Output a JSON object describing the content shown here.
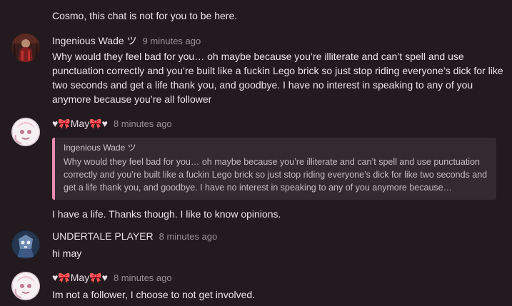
{
  "messages": [
    {
      "text": "Cosmo, this chat is not for you to be here."
    },
    {
      "username": "Ingenious Wade ツ",
      "time": "9 minutes ago",
      "text": "Why would they feel bad for you… oh maybe because you’re illiterate and can’t spell and use punctuation correctly and you’re built like a fuckin Lego brick so just stop riding everyone’s dick for like two seconds and get a life thank you, and goodbye. I have no interest in speaking to any of you anymore because you’re all follower"
    },
    {
      "username": "♥🎀May🎀♥",
      "time": "8 minutes ago",
      "reply": {
        "author": "Ingenious Wade ツ",
        "text": "Why would they feel bad for you… oh maybe because you’re illiterate and can’t spell and use punctuation correctly and you’re built like a fuckin Lego brick so just stop riding everyone’s dick for like two seconds and get a life thank you, and goodbye. I have no interest in speaking to any of you anymore because…"
      },
      "text": "I have a life. Thanks though. I like to know opinions."
    },
    {
      "username": "UNDERTALE PLAYER",
      "time": "8 minutes ago",
      "text": "hi may"
    },
    {
      "username": "♥🎀May🎀♥",
      "time": "8 minutes ago",
      "text": "Im not a follower, I choose to not get involved."
    }
  ],
  "colors": {
    "background": "#221a1e",
    "reply_border": "#e88bb2",
    "reply_background": "#34292f",
    "timestamp": "#9a9095"
  },
  "icons": {
    "wade_avatar": "user-avatar-dark-red",
    "may_avatar": "user-avatar-pink-white",
    "undertale_avatar": "user-avatar-blue-character"
  }
}
